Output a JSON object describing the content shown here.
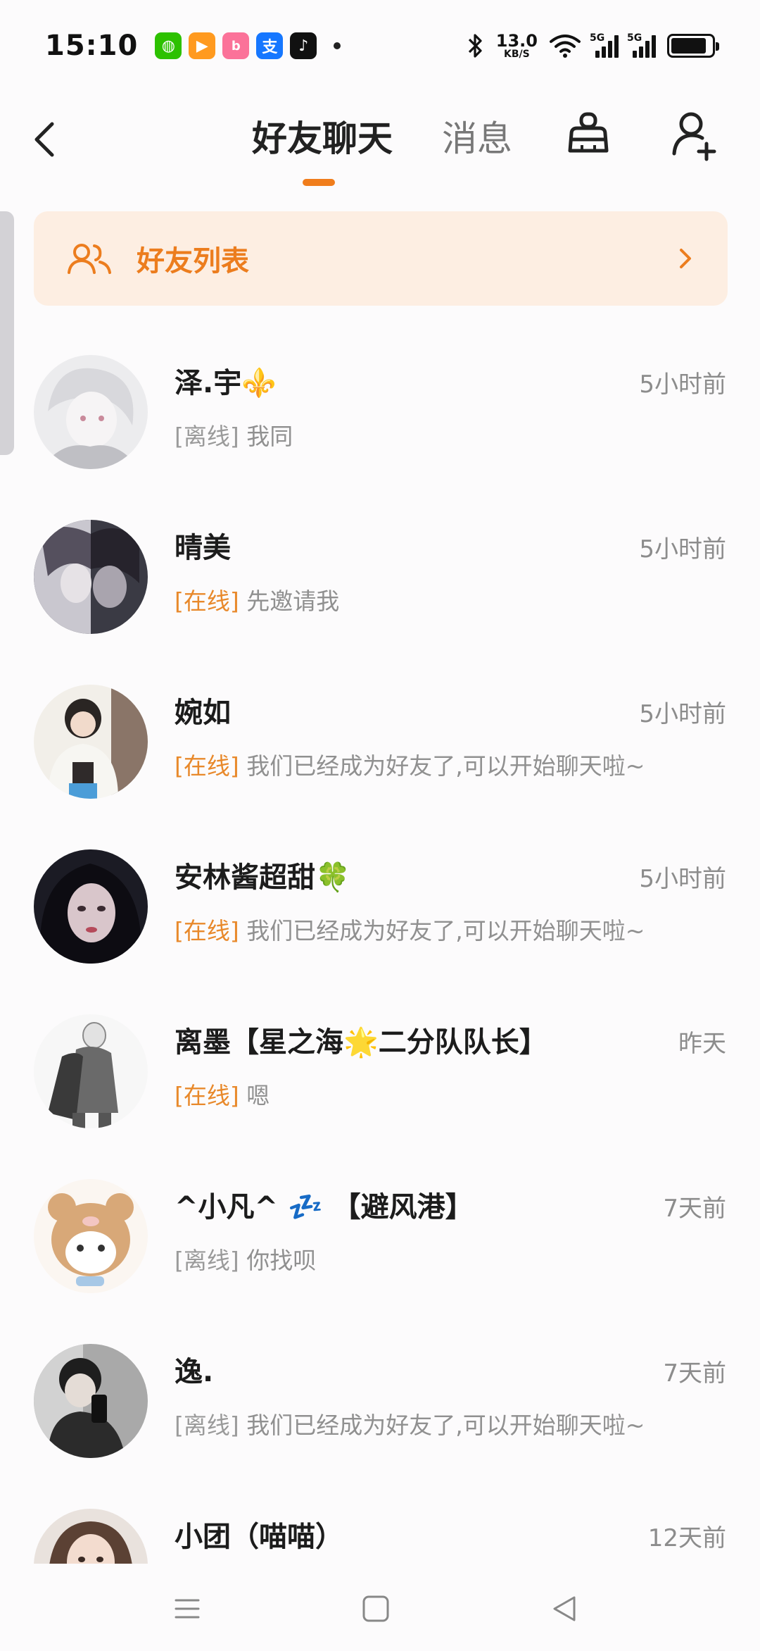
{
  "status_bar": {
    "time": "15:10",
    "apps": [
      {
        "name": "wechat-icon",
        "color": "#2dc100",
        "glyph": "◍"
      },
      {
        "name": "video-app-icon",
        "color": "#ff9a1f",
        "glyph": "▶"
      },
      {
        "name": "bilibili-icon",
        "color": "#fb7299",
        "glyph": "b"
      },
      {
        "name": "alipay-icon",
        "color": "#1677ff",
        "glyph": "支"
      },
      {
        "name": "tiktok-icon",
        "color": "#111111",
        "glyph": "♪"
      }
    ],
    "net_speed_value": "13.0",
    "net_speed_unit": "KB/S",
    "signal_1_label": "5G",
    "signal_2_label": "5G",
    "battery_level": 0.88
  },
  "header": {
    "tab_friends": "好友聊天",
    "tab_messages": "消息",
    "active_tab": "好友聊天"
  },
  "friend_banner": {
    "label": "好友列表"
  },
  "chats": [
    {
      "name": "泽.宇⚜️",
      "time": "5小时前",
      "status": "[离线]",
      "online": false,
      "message": "我同"
    },
    {
      "name": "晴美",
      "time": "5小时前",
      "status": "[在线]",
      "online": true,
      "message": "先邀请我"
    },
    {
      "name": "婉如",
      "time": "5小时前",
      "status": "[在线]",
      "online": true,
      "message": "我们已经成为好友了,可以开始聊天啦~"
    },
    {
      "name": "安林酱超甜🍀",
      "time": "5小时前",
      "status": "[在线]",
      "online": true,
      "message": "我们已经成为好友了,可以开始聊天啦~"
    },
    {
      "name": "离墨【星之海🌟二分队队长】",
      "time": "昨天",
      "status": "[在线]",
      "online": true,
      "message": "嗯"
    },
    {
      "name": "^小凡^ 💤 【避风港】",
      "time": "7天前",
      "status": "[离线]",
      "online": false,
      "message": "你找呗"
    },
    {
      "name": "逸.",
      "time": "7天前",
      "status": "[离线]",
      "online": false,
      "message": "我们已经成为好友了,可以开始聊天啦~"
    },
    {
      "name": "小团（喵喵）",
      "time": "12天前",
      "status": "",
      "online": false,
      "message": ""
    }
  ],
  "colors": {
    "accent": "#f07d1c",
    "online": "#e8892b",
    "banner_bg": "#fdeee2"
  }
}
